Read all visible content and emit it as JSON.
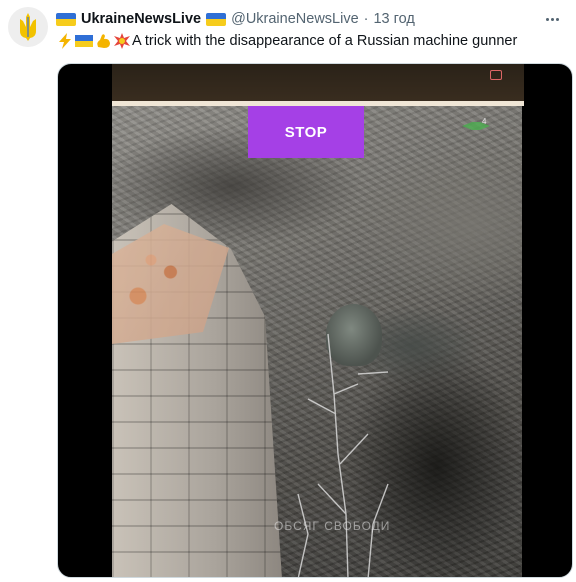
{
  "tweet": {
    "account_name": "UkraineNewsLive",
    "handle": "@UkraineNewsLive",
    "separator": "·",
    "time": "13 год",
    "text": "A trick with the disappearance of a Russian machine gunner",
    "emojis": [
      "high-voltage",
      "ukraine-flag",
      "flexed-biceps",
      "collision"
    ]
  },
  "media": {
    "type": "video-still",
    "overlay_label": "STOP",
    "watermark": "ОБСЯГ СВОБОДИ"
  },
  "colors": {
    "flag_blue": "#2f6fd6",
    "flag_yellow": "#f6cc1c",
    "overlay_purple": "#a540e6",
    "text_primary": "#0f1419",
    "text_secondary": "#536471",
    "border": "#cfd9de"
  },
  "icons": [
    "ukraine-emblem-icon",
    "more-options-icon"
  ]
}
